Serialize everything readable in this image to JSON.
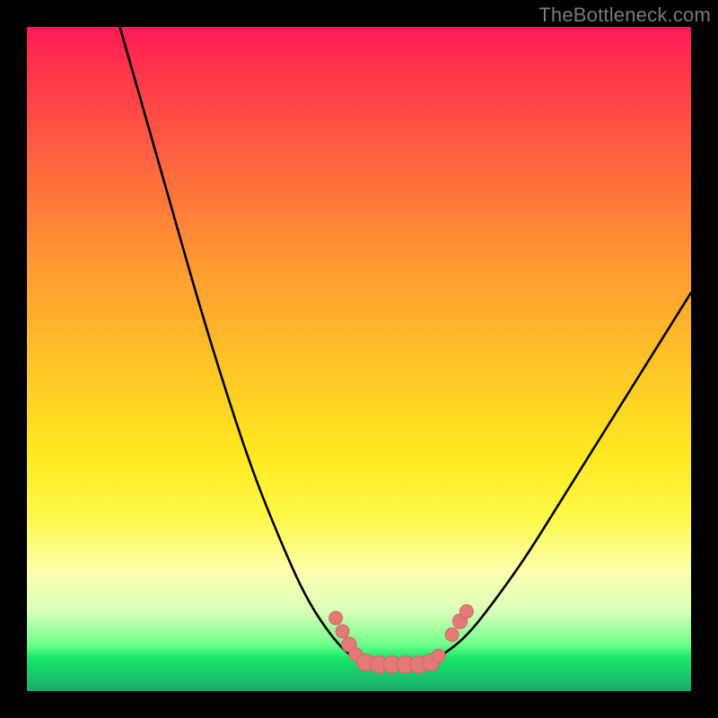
{
  "watermark": {
    "text": "TheBottleneck.com"
  },
  "colors": {
    "page_bg": "#000000",
    "curve": "#000000",
    "marker_fill": "#e47a78",
    "marker_stroke": "#d46563",
    "gradient_stops": [
      "#ff1a55",
      "#ff3a4a",
      "#ff6a3e",
      "#ff9a32",
      "#ffc726",
      "#ffe81e",
      "#fff84a",
      "#fdffb0",
      "#d9ffb8",
      "#6fff8a",
      "#17e86b",
      "#19c96a",
      "#1aab69"
    ]
  },
  "chart_data": {
    "type": "line",
    "title": "",
    "xlabel": "",
    "ylabel": "",
    "xlim": [
      0,
      100
    ],
    "ylim": [
      0,
      100
    ],
    "note": "Axes are unlabeled in the image; x/y are normalized 0–100 reading left→right and bottom→top. The curve resembles a bottleneck/mismatch plot with a flat minimum near x≈50–60.",
    "series": [
      {
        "name": "curve-left-branch",
        "x": [
          14,
          18,
          22,
          26,
          30,
          34,
          38,
          42,
          46,
          49
        ],
        "y": [
          100,
          86,
          72,
          58,
          45,
          33,
          23,
          14,
          8,
          5
        ]
      },
      {
        "name": "curve-flat-bottom",
        "x": [
          49,
          52,
          55,
          58,
          60,
          62
        ],
        "y": [
          5,
          4,
          4,
          4,
          4,
          5
        ]
      },
      {
        "name": "curve-right-branch",
        "x": [
          62,
          66,
          70,
          75,
          80,
          85,
          90,
          95,
          100
        ],
        "y": [
          5,
          8,
          13,
          20,
          28,
          36,
          44,
          52,
          60
        ]
      }
    ],
    "markers": {
      "name": "highlight-dots",
      "points": [
        {
          "x": 46.5,
          "y": 11.0,
          "r": 1.0
        },
        {
          "x": 47.5,
          "y": 9.0,
          "r": 1.0
        },
        {
          "x": 48.5,
          "y": 7.0,
          "r": 1.1
        },
        {
          "x": 49.5,
          "y": 5.5,
          "r": 1.0
        },
        {
          "x": 51.0,
          "y": 4.3,
          "r": 1.3
        },
        {
          "x": 53.0,
          "y": 4.0,
          "r": 1.3
        },
        {
          "x": 55.0,
          "y": 4.0,
          "r": 1.3
        },
        {
          "x": 57.0,
          "y": 4.0,
          "r": 1.3
        },
        {
          "x": 59.0,
          "y": 4.0,
          "r": 1.3
        },
        {
          "x": 60.8,
          "y": 4.3,
          "r": 1.3
        },
        {
          "x": 62.0,
          "y": 5.3,
          "r": 1.0
        },
        {
          "x": 64.0,
          "y": 8.5,
          "r": 1.0
        },
        {
          "x": 65.2,
          "y": 10.5,
          "r": 1.1
        },
        {
          "x": 66.2,
          "y": 12.0,
          "r": 1.0
        }
      ]
    }
  }
}
